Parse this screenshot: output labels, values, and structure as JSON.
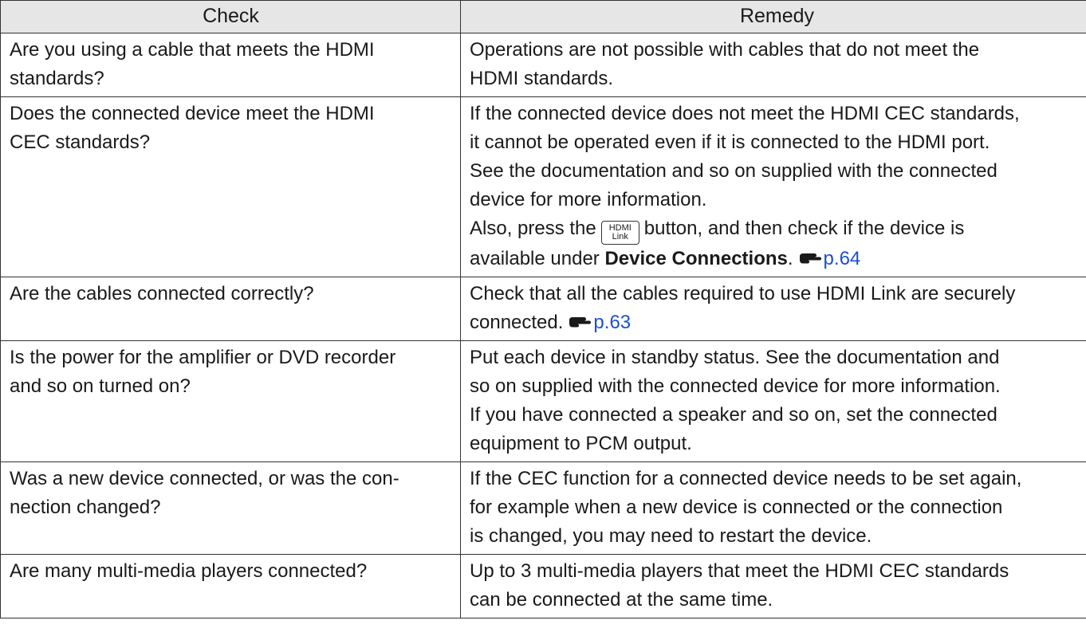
{
  "headers": {
    "check": "Check",
    "remedy": "Remedy"
  },
  "rows": [
    {
      "check": [
        "Are you using a cable that meets the HDMI",
        "standards?"
      ],
      "remedy": [
        "Operations are not possible with cables that do not meet the",
        "HDMI standards."
      ]
    },
    {
      "check": [
        "Does the connected device meet the HDMI",
        "CEC standards?"
      ],
      "remedy": [
        "If the connected device does not meet the HDMI CEC standards,",
        "it cannot be operated even if it is connected to the HDMI port.",
        "See the documentation and so on supplied with the connected",
        "device for more information."
      ],
      "remedy_extra": {
        "line5_before": "Also, press the",
        "button_top": "HDMI",
        "button_bottom": "Link",
        "line5_after": "button, and then check if the device is",
        "line6_before": "available under",
        "menu": "Device Connections",
        "line6_period": ".",
        "page_ref": "p.64"
      }
    },
    {
      "check": [
        "Are the cables connected correctly?"
      ],
      "remedy": [
        "Check that all the cables required to use HDMI Link are securely"
      ],
      "remedy_last": "connected.",
      "page_ref": "p.63"
    },
    {
      "check": [
        "Is the power for the amplifier or DVD recorder",
        "and so on turned on?"
      ],
      "remedy": [
        "Put each device in standby status. See the documentation and",
        "so on supplied with the connected device for more information.",
        "If you have connected a speaker and so on, set the connected",
        "equipment to PCM output."
      ]
    },
    {
      "check": [
        "Was a new device connected, or was the con-",
        "nection changed?"
      ],
      "remedy": [
        "If the CEC function for a connected device needs to be set again,",
        "for example when a new device is connected or the connection",
        "is changed, you may need to restart the device."
      ]
    },
    {
      "check": [
        "Are many multi-media players connected?"
      ],
      "remedy": [
        "Up to 3 multi-media players that meet the HDMI CEC standards",
        "can be connected at the same time."
      ]
    }
  ],
  "icons": {
    "page_ref_icon": "pointing-hand-icon"
  },
  "colors": {
    "link": "#1a4fd6",
    "header_bg": "#e6e6e6"
  }
}
